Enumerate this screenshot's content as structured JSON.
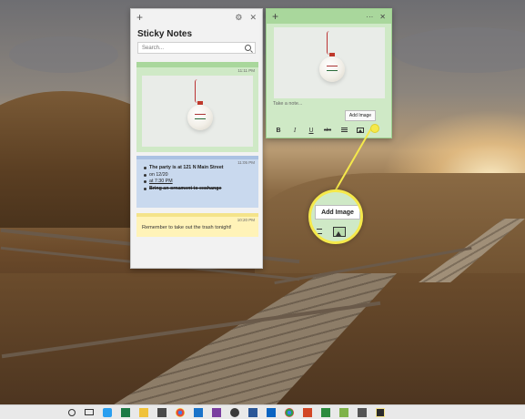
{
  "list_window": {
    "title": "Sticky Notes",
    "search_placeholder": "Search...",
    "notes": [
      {
        "time": "11:11 PM",
        "kind": "image"
      },
      {
        "time": "11:05 PM",
        "kind": "list",
        "items": [
          "The party is at 121 N Main Street",
          "on 12/20",
          "at 7:30 PM",
          "Bring an ornament to exchange"
        ]
      },
      {
        "time": "10:20 PM",
        "kind": "text",
        "text": "Remember to take out the trash tonight!"
      }
    ]
  },
  "edit_window": {
    "placeholder": "Take a note...",
    "tooltip": "Add Image",
    "toolbar": {
      "bold": "B",
      "italic": "I",
      "underline": "U",
      "strike": "abc"
    }
  },
  "callout": {
    "label": "Add Image"
  },
  "colors": {
    "green_note": "#cfe9c6",
    "green_header": "#a9d79c",
    "blue_note": "#c9d9ee",
    "yellow_note": "#fff3b8",
    "callout": "#f5e94b"
  },
  "taskbar_icons": [
    "cortana-icon",
    "task-view-icon",
    "edge-icon",
    "excel-icon",
    "explorer-icon",
    "store-icon",
    "chrome-icon",
    "mail-icon",
    "paint-icon",
    "photos-icon",
    "word-icon",
    "outlook-icon",
    "chrome2-icon",
    "powerpoint-icon",
    "defender-icon",
    "snip-icon",
    "settings-icon",
    "sticky-notes-icon"
  ]
}
